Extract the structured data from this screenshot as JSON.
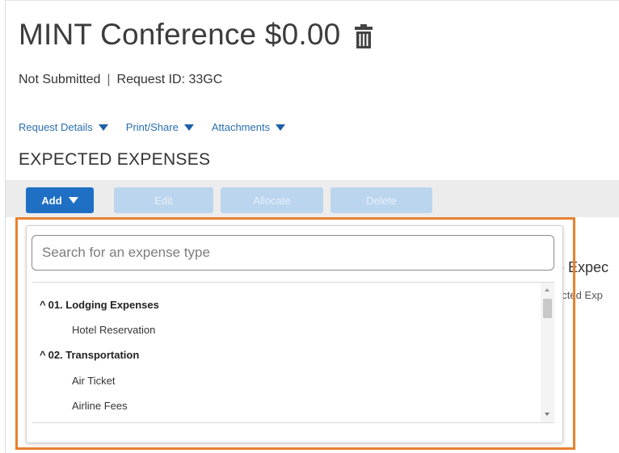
{
  "header": {
    "title": "MINT Conference $0.00",
    "status": "Not Submitted",
    "separator": "|",
    "request_id": "Request ID: 33GC"
  },
  "links": [
    {
      "label": "Request Details"
    },
    {
      "label": "Print/Share"
    },
    {
      "label": "Attachments"
    }
  ],
  "section": {
    "title": "EXPECTED EXPENSES"
  },
  "toolbar": {
    "add_label": "Add",
    "edit_label": "Edit",
    "allocate_label": "Allocate",
    "delete_label": "Delete"
  },
  "background_panel": {
    "title_fragment": "o Expec",
    "subtitle_fragment": "ected Exp"
  },
  "dropdown": {
    "search_placeholder": "Search for an expense type",
    "groups": [
      {
        "chevron": "^",
        "label": "01. Lodging Expenses",
        "items": [
          "Hotel Reservation"
        ]
      },
      {
        "chevron": "^",
        "label": "02. Transportation",
        "items": [
          "Air Ticket",
          "Airline Fees"
        ]
      }
    ]
  },
  "colors": {
    "accent_blue": "#1f6fc5",
    "link_blue": "#2a6fb0",
    "highlight_orange": "#e8822f",
    "disabled_button": "#bcd5ee",
    "toolbar_bg": "#ececec"
  },
  "icons": {
    "trash": "trash-icon",
    "caret": "caret-down-icon"
  }
}
